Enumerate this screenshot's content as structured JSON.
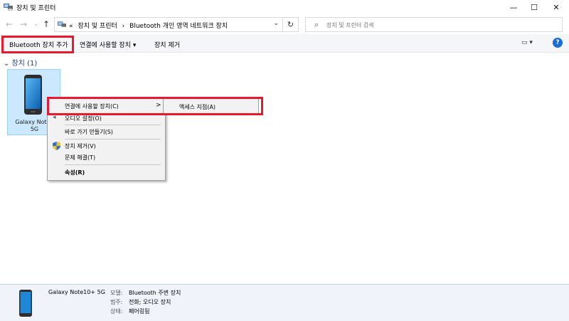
{
  "window": {
    "title": "장치 및 프린터"
  },
  "window_controls": {
    "minimize": "—",
    "maximize": "☐",
    "close": "✕"
  },
  "nav": {
    "back": "←",
    "forward": "→",
    "up": "↑"
  },
  "address": {
    "prefix": "«",
    "crumbs": [
      "장치 및 프린터",
      "Bluetooth 개인 영역 네트워크 장치"
    ],
    "separator": "›",
    "dropdown": "⌄",
    "refresh": "↻"
  },
  "search": {
    "placeholder": "장치 및 프린터 검색"
  },
  "commandbar": {
    "add_bluetooth": "Bluetooth 장치 추가",
    "connect_using": "연결에 사용할 장치",
    "connect_chevron": "▾",
    "remove_device": "장치 제거",
    "view": "▭ ▾",
    "help": "?"
  },
  "group": {
    "label": "장치 (1)",
    "chevron": "⌄"
  },
  "device": {
    "name_line1": "Galaxy Note1",
    "name_line2": "5G"
  },
  "context_menu": {
    "items": [
      {
        "label": "연결에 사용할 장치(C)",
        "arrow": ">"
      },
      {
        "label": "오디오 설정(O)"
      },
      {
        "label": "바로 가기 만들기(S)"
      },
      {
        "label": "장치 제거(V)"
      },
      {
        "label": "문제 해결(T)"
      },
      {
        "label": "속성(R)"
      }
    ]
  },
  "submenu": {
    "items": [
      {
        "label": "액세스 지점(A)"
      }
    ]
  },
  "details": {
    "device_name": "Galaxy Note10+ 5G",
    "model_key": "모델:",
    "model_value": "Bluetooth 주변 장치",
    "category_key": "범주:",
    "category_value": "전화; 오디오 장치",
    "status_key": "상태:",
    "status_value": "페어링됨"
  },
  "colors": {
    "highlight": "#e8192c",
    "selection": "#cce8ff",
    "help": "#1a6ed8"
  }
}
